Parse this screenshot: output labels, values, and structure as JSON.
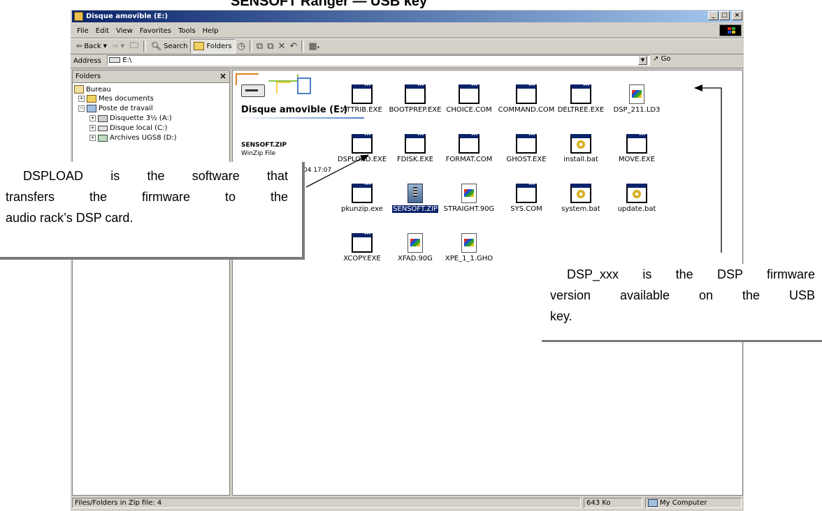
{
  "header_fragment": "SENSOFT Ranger — USB key",
  "window": {
    "title": "Disque amovible (E:)",
    "buttons": [
      "_",
      "□",
      "×"
    ]
  },
  "menu": [
    "File",
    "Edit",
    "View",
    "Favorites",
    "Tools",
    "Help"
  ],
  "toolbar": {
    "back_label": "Back",
    "search_label": "Search",
    "folders_label": "Folders",
    "icons": [
      "back-arrow-icon",
      "forward-arrow-icon",
      "up-folder-icon",
      "search-icon",
      "folders-icon",
      "history-icon",
      "move-to-icon",
      "copy-to-icon",
      "delete-icon",
      "undo-icon",
      "views-icon"
    ]
  },
  "address": {
    "label": "Address",
    "value": "E:\\",
    "go_label": "Go"
  },
  "folders_pane": {
    "title": "Folders",
    "close_glyph": "×",
    "items": [
      {
        "label": "Bureau"
      },
      {
        "label": "Mes documents"
      },
      {
        "label": "Poste de travail"
      },
      {
        "label": "Disquette 3½ (A:)"
      },
      {
        "label": "Disque local (C:)"
      },
      {
        "label": "Archives UGS8 (D:)"
      }
    ]
  },
  "content": {
    "drive_title": "Disque amovible (E:)",
    "selected_name": "SENSOFT.ZIP",
    "selected_type": "WinZip File",
    "selected_date_fragment": "04 17:07",
    "files": [
      {
        "name": "ATTRIB.EXE",
        "type": "exe"
      },
      {
        "name": "BOOTPREP.EXE",
        "type": "exe"
      },
      {
        "name": "CHOICE.COM",
        "type": "exe"
      },
      {
        "name": "COMMAND.COM",
        "type": "exe"
      },
      {
        "name": "DELTREE.EXE",
        "type": "exe"
      },
      {
        "name": "DSP_211.LD3",
        "type": "doc"
      },
      {
        "name": "DSPLOAD.EXE",
        "type": "exe"
      },
      {
        "name": "FDISK.EXE",
        "type": "exe"
      },
      {
        "name": "FORMAT.COM",
        "type": "exe"
      },
      {
        "name": "GHOST.EXE",
        "type": "exe"
      },
      {
        "name": "install.bat",
        "type": "bat"
      },
      {
        "name": "MOVE.EXE",
        "type": "exe"
      },
      {
        "name": "pkunzip.exe",
        "type": "exe"
      },
      {
        "name": "SENSOFT.ZIP",
        "type": "zip",
        "selected": true
      },
      {
        "name": "STRAIGHT.90G",
        "type": "doc"
      },
      {
        "name": "SYS.COM",
        "type": "exe"
      },
      {
        "name": "system.bat",
        "type": "bat"
      },
      {
        "name": "update.bat",
        "type": "bat"
      },
      {
        "name": "XCOPY.EXE",
        "type": "exe"
      },
      {
        "name": "XFAD.90G",
        "type": "doc"
      },
      {
        "name": "XPE_1_1.GHO",
        "type": "doc"
      }
    ]
  },
  "statusbar": {
    "text": "Files/Folders in Zip file: 4",
    "size": "643 Ko",
    "zone": "My Computer"
  },
  "callouts": {
    "dspload_lines": [
      "DSPLOAD is the software that",
      "transfers the firmware to the",
      "audio rack’s DSP card."
    ],
    "dsp_lines": [
      "DSP_xxx is the DSP firmware",
      "version available on the USB",
      "key."
    ]
  },
  "colors": {
    "titlebar": "#0a246a",
    "selection": "#0a246a",
    "chrome": "#d4d0c8"
  }
}
